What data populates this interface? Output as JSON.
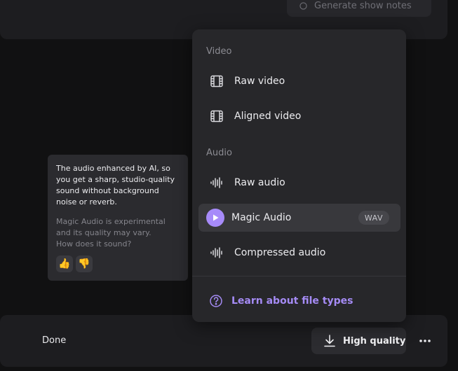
{
  "header": {
    "generate_label": "Generate show notes"
  },
  "tooltip": {
    "main_text": "The audio enhanced by AI, so you get a sharp, studio-quality sound without background noise or reverb.",
    "sub_text_1": "Magic Audio is experimental and its quality may vary.",
    "sub_text_2": "How does it sound?",
    "thumbs_up": "👍",
    "thumbs_down": "👎"
  },
  "dropdown": {
    "video_label": "Video",
    "video_items": [
      {
        "label": "Raw video",
        "icon": "film-icon"
      },
      {
        "label": "Aligned video",
        "icon": "film-icon"
      }
    ],
    "audio_label": "Audio",
    "audio_items": [
      {
        "label": "Raw audio",
        "icon": "waveform-icon"
      },
      {
        "label": "Magic Audio",
        "icon": "play-icon",
        "badge": "WAV",
        "selected": true
      },
      {
        "label": "Compressed audio",
        "icon": "waveform-icon"
      }
    ],
    "learn_label": "Learn about file types"
  },
  "footer": {
    "done_label": "Done",
    "download_label": "High quality"
  },
  "colors": {
    "accent": "#a78bfa",
    "panel": "#27272a",
    "background": "#111112"
  }
}
